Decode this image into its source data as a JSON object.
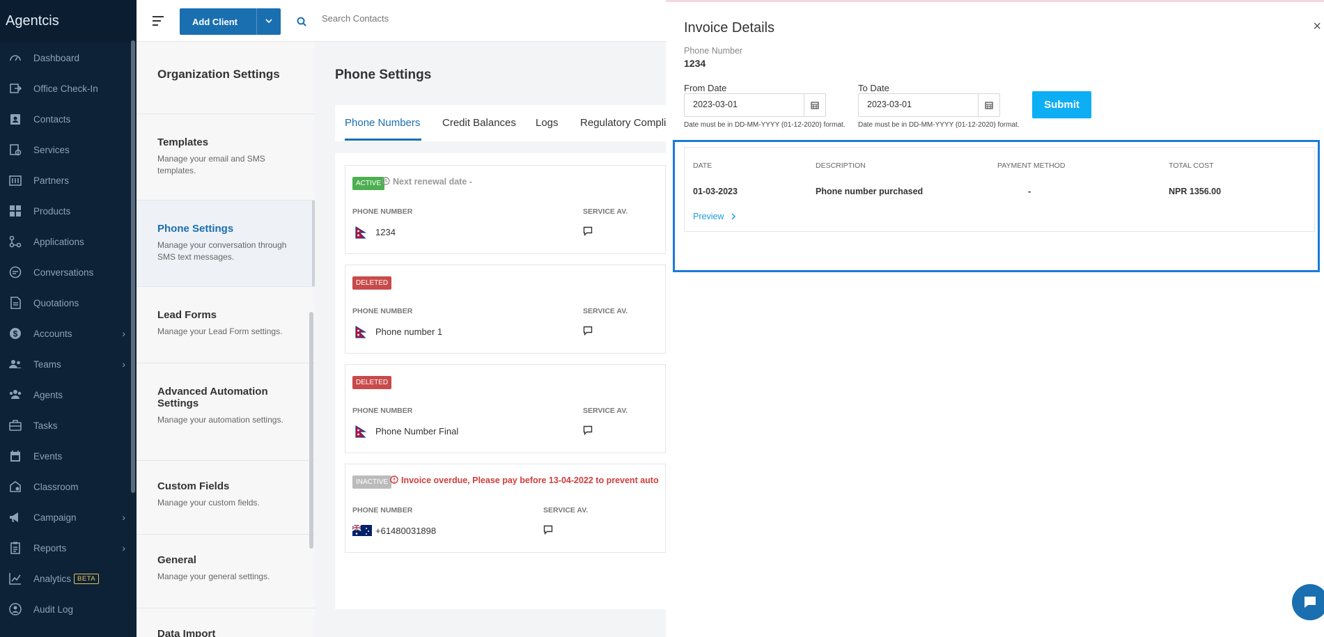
{
  "app": {
    "brand": "Agentcis"
  },
  "sidebar": {
    "items": [
      {
        "label": "Dashboard",
        "icon": "dashboard-icon",
        "chevron": false
      },
      {
        "label": "Office Check-In",
        "icon": "check-in-icon",
        "chevron": false
      },
      {
        "label": "Contacts",
        "icon": "contacts-icon",
        "chevron": false
      },
      {
        "label": "Services",
        "icon": "services-icon",
        "chevron": false
      },
      {
        "label": "Partners",
        "icon": "partners-icon",
        "chevron": false
      },
      {
        "label": "Products",
        "icon": "products-icon",
        "chevron": false
      },
      {
        "label": "Applications",
        "icon": "applications-icon",
        "chevron": false
      },
      {
        "label": "Conversations",
        "icon": "conversations-icon",
        "chevron": false
      },
      {
        "label": "Quotations",
        "icon": "quotations-icon",
        "chevron": false
      },
      {
        "label": "Accounts",
        "icon": "accounts-icon",
        "chevron": true
      },
      {
        "label": "Teams",
        "icon": "teams-icon",
        "chevron": true
      },
      {
        "label": "Agents",
        "icon": "agents-icon",
        "chevron": false
      },
      {
        "label": "Tasks",
        "icon": "tasks-icon",
        "chevron": false
      },
      {
        "label": "Events",
        "icon": "events-icon",
        "chevron": false
      },
      {
        "label": "Classroom",
        "icon": "classroom-icon",
        "chevron": false
      },
      {
        "label": "Campaign",
        "icon": "campaign-icon",
        "chevron": true
      },
      {
        "label": "Reports",
        "icon": "reports-icon",
        "chevron": true
      },
      {
        "label": "Analytics",
        "icon": "analytics-icon",
        "chevron": false,
        "badge": "BETA"
      },
      {
        "label": "Audit Log",
        "icon": "audit-log-icon",
        "chevron": false
      }
    ]
  },
  "topbar": {
    "add_client_label": "Add Client",
    "search_placeholder": "Search Contacts"
  },
  "settings": {
    "heading": "Organization Settings",
    "items": [
      {
        "title": "Templates",
        "desc": "Manage your email and SMS templates."
      },
      {
        "title": "Phone Settings",
        "desc": "Manage your conversation through SMS text messages."
      },
      {
        "title": "Lead Forms",
        "desc": "Manage your Lead Form settings."
      },
      {
        "title": "Advanced Automation Settings",
        "desc": "Manage your automation settings."
      },
      {
        "title": "Custom Fields",
        "desc": "Manage your custom fields."
      },
      {
        "title": "General",
        "desc": "Manage your general settings."
      },
      {
        "title": "Data Import",
        "desc": ""
      }
    ]
  },
  "phone_settings": {
    "title": "Phone Settings",
    "tabs": [
      "Phone Numbers",
      "Credit Balances",
      "Logs",
      "Regulatory Compli"
    ],
    "col_phone": "PHONE NUMBER",
    "col_service": "SERVICE AV.",
    "cards": [
      {
        "status": "ACTIVE",
        "note": "Next renewal date -",
        "number": "1234"
      },
      {
        "status": "DELETED",
        "note": "",
        "number": "Phone number 1"
      },
      {
        "status": "DELETED",
        "note": "",
        "number": "Phone Number Final"
      },
      {
        "status": "INACTIVE",
        "note": "Invoice overdue, Please pay before 13-04-2022 to prevent auto",
        "number": "+61480031898"
      }
    ]
  },
  "invoice": {
    "title": "Invoice Details",
    "close": "×",
    "phone_label": "Phone Number",
    "phone_value": "1234",
    "from_label": "From Date",
    "from_value": "2023-03-01",
    "to_label": "To Date",
    "to_value": "2023-03-01",
    "hint": "Date must be in DD-MM-YYYY (01-12-2020) format.",
    "submit_label": "Submit",
    "columns": [
      "DATE",
      "DESCRIPTION",
      "PAYMENT METHOD",
      "TOTAL COST"
    ],
    "row": {
      "date": "01-03-2023",
      "description": "Phone number purchased",
      "method": "-",
      "cost": "NPR 1356.00"
    },
    "preview_label": "Preview"
  },
  "colors": {
    "sidebar_bg": "#0d2137",
    "primary": "#1a6fb0",
    "submit": "#0eaef5",
    "highlight": "#1a7bdc",
    "active_badge": "#4caf50",
    "deleted_badge": "#c94a4a",
    "overdue_text": "#d13d3d"
  }
}
